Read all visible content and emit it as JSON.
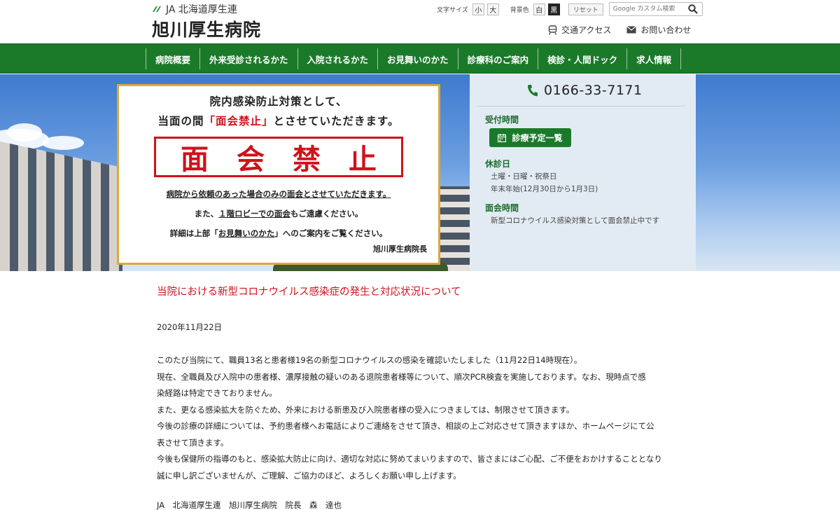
{
  "header": {
    "org_name": "JA 北海道厚生連",
    "hospital_name": "旭川厚生病院",
    "font_size_label": "文字サイズ",
    "font_small": "小",
    "font_large": "大",
    "bg_color_label": "背景色",
    "bg_white": "白",
    "bg_black": "黒",
    "reset_label": "リセット",
    "search_placeholder": "Google カスタム検索",
    "access_label": "交通アクセス",
    "contact_label": "お問い合わせ"
  },
  "nav": {
    "items": [
      "病院概要",
      "外来受診されるかた",
      "入院されるかた",
      "お見舞いのかた",
      "診療科のご案内",
      "検診・人間ドック",
      "求人情報"
    ]
  },
  "notice": {
    "line1": "院内感染防止対策として、",
    "line2_prefix": "当面の間",
    "line2_highlight": "「面会禁止」",
    "line2_suffix": "とさせていただきます。",
    "stamp": "面会禁止",
    "line3": "病院から依頼のあった場合のみの面会とさせていただきます。",
    "line4_prefix": "また、",
    "line4_underline": "１階ロビーでの面会",
    "line4_suffix": "もご遠慮ください。",
    "line5_prefix": "詳細は上部「",
    "line5_underline": "お見舞いのかた",
    "line5_suffix": "」へのご案内をご覧ください。",
    "signature": "旭川厚生病院長"
  },
  "info": {
    "phone": "0166-33-7171",
    "reception_heading": "受付時間",
    "schedule_button": "診療予定一覧",
    "holidays_heading": "休診日",
    "holidays_line1": "土曜・日曜・祝祭日",
    "holidays_line2": "年末年始(12月30日から1月3日)",
    "visiting_heading": "面会時間",
    "visiting_text": "新型コロナウイルス感染対策として面会禁止中です"
  },
  "article": {
    "title": "当院における新型コロナウイルス感染症の発生と対応状況について",
    "date": "2020年11月22日",
    "paragraphs": [
      "このたび当院にて、職員13名と患者様19名の新型コロナウイルスの感染を確認いたしました（11月22日14時現在）。",
      "現在、全職員及び入院中の患者様、濃厚接触の疑いのある退院患者様等について、順次PCR検査を実施しております。なお、現時点で感",
      "染経路は特定できておりません。",
      "また、更なる感染拡大を防ぐため、外来における新患及び入院患者様の受入につきましては、制限させて頂きます。",
      "今後の診療の詳細については、予約患者様へお電話によりご連絡をさせて頂き、相談の上ご対応させて頂きますほか、ホームページにて公",
      "表させて頂きます。",
      "今後も保健所の指導のもと、感染拡大防止に向け、適切な対応に努めてまいりますので、皆さまにはご心配、ご不便をおかけすることとなり",
      "誠に申し訳ございませんが、ご理解、ご協力のほど、よろしくお願い申し上げます。"
    ],
    "signature": "JA　北海道厚生連　旭川厚生病院　院長　森　達也"
  },
  "colors": {
    "brand_green": "#1b7a2a",
    "alert_red": "#d0121b",
    "notice_border": "#d9a93a"
  }
}
